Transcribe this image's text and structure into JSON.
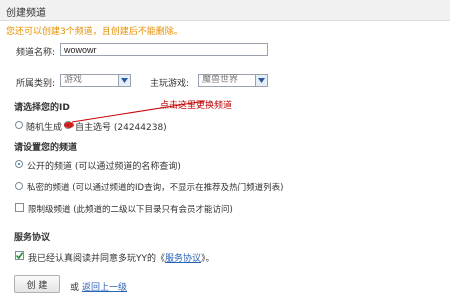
{
  "header": {
    "title": "创建频道"
  },
  "notice": "您还可以创建3个频道，且创建后不能删除。",
  "form": {
    "channel_name_label": "频道名称:",
    "channel_name_value": "wowowr",
    "category_label": "所属类别:",
    "category_value": "游戏",
    "game_label": "主玩游戏:",
    "game_value": "魔兽世界"
  },
  "id_section": {
    "title": "请选择您的ID",
    "option_random": "随机生成",
    "option_own": "自主选号 (24244238)",
    "annotation": "点击这里更换频道"
  },
  "channel_section": {
    "title": "请设置您的频道",
    "option_public": "公开的频道 (可以通过频道的名称查询)",
    "option_private": "私密的频道 (可以通过频道的ID查询，不显示在推荐及热门频道列表)",
    "option_restricted": "限制级频道 (此频道的二级以下目录只有会员才能访问)"
  },
  "service_section": {
    "title": "服务协议",
    "agree_prefix": "我已经认真阅读并同意多玩YY的《",
    "agree_link": "服务协议",
    "agree_suffix": "》。"
  },
  "footer": {
    "create_button": "创 建",
    "or_text": "或",
    "back_link": "返回上一级"
  },
  "colors": {
    "notice": "#e58f00",
    "annotation": "#c00000",
    "link": "#2a62b8",
    "check": "#1a8f2e"
  },
  "icons": {
    "dropdown": "chevron-down-icon",
    "check": "check-icon"
  }
}
